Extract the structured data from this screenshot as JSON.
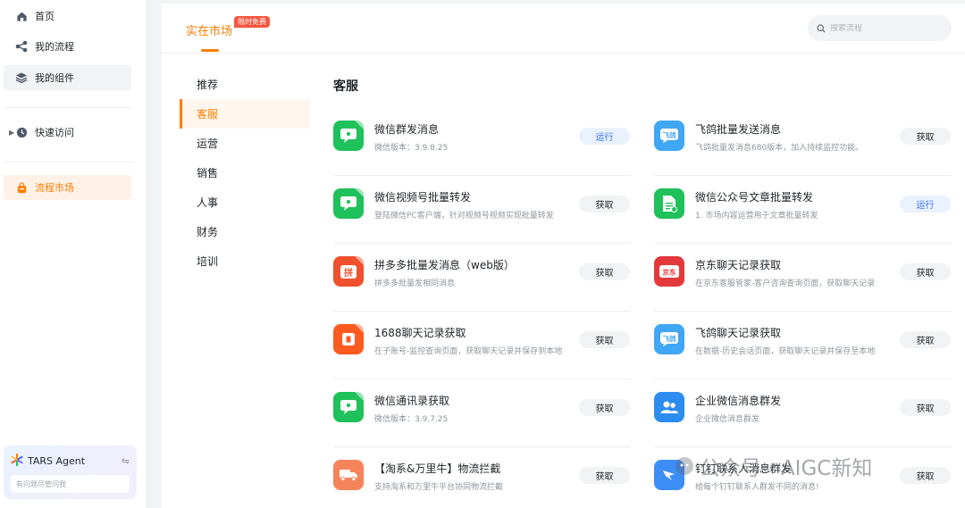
{
  "sidebar": {
    "items": [
      {
        "label": "首页",
        "icon": "home-icon"
      },
      {
        "label": "我的流程",
        "icon": "flow-icon"
      },
      {
        "label": "我的组件",
        "icon": "layers-icon"
      },
      {
        "label": "快速访问",
        "icon": "clock-icon"
      },
      {
        "label": "流程市场",
        "icon": "bag-icon"
      }
    ],
    "agent": {
      "name": "TARS Agent",
      "placeholder": "有问题尽管问我"
    }
  },
  "header": {
    "title": "实在市场",
    "badge": "限时免费",
    "search_placeholder": "搜索流程"
  },
  "categories": [
    "推荐",
    "客服",
    "运营",
    "销售",
    "人事",
    "财务",
    "培训"
  ],
  "active_category": "客服",
  "section_title": "客服",
  "cards": [
    {
      "title": "微信群发消息",
      "desc": "微信版本：3.9.8.25",
      "button": "运行",
      "icon": "wechat-icon",
      "color": "#1fc15a"
    },
    {
      "title": "飞鸽批量发送消息",
      "desc": "飞鸽批量发消息680版本，加入持续监控功能。",
      "button": "获取",
      "icon": "feige-icon",
      "color": "#3fa7f5",
      "icon_text": "飞鸽"
    },
    {
      "title": "微信视频号批量转发",
      "desc": "登陆微信PC客户端，针对视频号视频实现批量转发",
      "button": "获取",
      "icon": "wechat-icon",
      "color": "#1fc15a"
    },
    {
      "title": "微信公众号文章批量转发",
      "desc": "1. 市场内容运营用于文章批量转发",
      "button": "运行",
      "icon": "document-icon",
      "color": "#1fc15a"
    },
    {
      "title": "拼多多批量发消息（web版）",
      "desc": "拼多多批量发相同消息",
      "button": "获取",
      "icon": "pinduoduo-icon",
      "color": "#f0502e",
      "icon_text": "拼"
    },
    {
      "title": "京东聊天记录获取",
      "desc": "在京东客服管家-客户咨询查询页面，获取聊天记录",
      "button": "获取",
      "icon": "jd-icon",
      "color": "#e4393c",
      "icon_text": "京东"
    },
    {
      "title": "1688聊天记录获取",
      "desc": "在子账号-监控查询页面，获取聊天记录并保存到本地",
      "button": "获取",
      "icon": "1688-icon",
      "color": "#ff5a1f"
    },
    {
      "title": "飞鸽聊天记录获取",
      "desc": "在数据-历史会话页面，获取聊天记录并保存至本地",
      "button": "获取",
      "icon": "feige-icon",
      "color": "#3fa7f5",
      "icon_text": "飞鸽"
    },
    {
      "title": "微信通讯录获取",
      "desc": "微信版本：3.9.7.25",
      "button": "获取",
      "icon": "wechat-icon",
      "color": "#1fc15a"
    },
    {
      "title": "企业微信消息群发",
      "desc": "企业微信消息群发",
      "button": "获取",
      "icon": "wecom-icon",
      "color": "#2d8cf0"
    },
    {
      "title": "【淘系&万里牛】物流拦截",
      "desc": "支持淘系和万里牛平台协同物流拦截",
      "button": "获取",
      "icon": "truck-icon",
      "color": "#f6845a"
    },
    {
      "title": "钉钉联系人消息群发",
      "desc": "给每个钉钉联系人群发不同的消息!",
      "button": "获取",
      "icon": "dingtalk-icon",
      "color": "#3e8ef7"
    }
  ],
  "watermark": "公众号 · AIGC新知"
}
